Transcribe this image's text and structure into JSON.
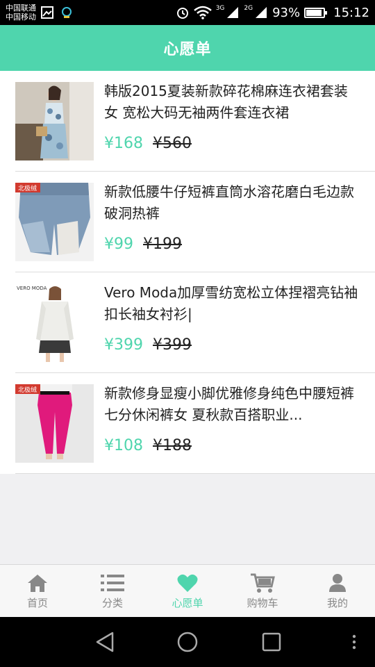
{
  "status_bar": {
    "carrier1": "中国联通",
    "carrier2": "中国移动",
    "net1": "3G",
    "net2": "2G",
    "battery": "93%",
    "battery_level": 0.93,
    "time": "15:12"
  },
  "header": {
    "title": "心愿单"
  },
  "items": [
    {
      "title": "韩版2015夏装新款碎花棉麻连衣裙套装女 宽松大码无袖两件套连衣裙",
      "price": "¥168",
      "original_price": "¥560"
    },
    {
      "title": "新款低腰牛仔短裤直筒水溶花磨白毛边款破洞热裤",
      "price": "¥99",
      "original_price": "¥199"
    },
    {
      "title": "Vero Moda加厚雪纺宽松立体捏褶亮钻袖扣长袖女衬衫|",
      "price": "¥399",
      "original_price": "¥399"
    },
    {
      "title": "新款修身显瘦小脚优雅修身纯色中腰短裤 七分休闲裤女 夏秋款百搭职业...",
      "price": "¥108",
      "original_price": "¥188"
    }
  ],
  "tabs": [
    {
      "label": "首页",
      "icon": "home-icon"
    },
    {
      "label": "分类",
      "icon": "list-icon"
    },
    {
      "label": "心愿单",
      "icon": "heart-icon"
    },
    {
      "label": "购物车",
      "icon": "cart-icon"
    },
    {
      "label": "我的",
      "icon": "person-icon"
    }
  ],
  "active_tab": 2,
  "colors": {
    "accent": "#4fd5ad",
    "tab_inactive": "#888888",
    "text": "#222222"
  },
  "brand_tags": {
    "item2": "北极绒",
    "item3": "VERO MODA",
    "item4": "北极绒"
  }
}
